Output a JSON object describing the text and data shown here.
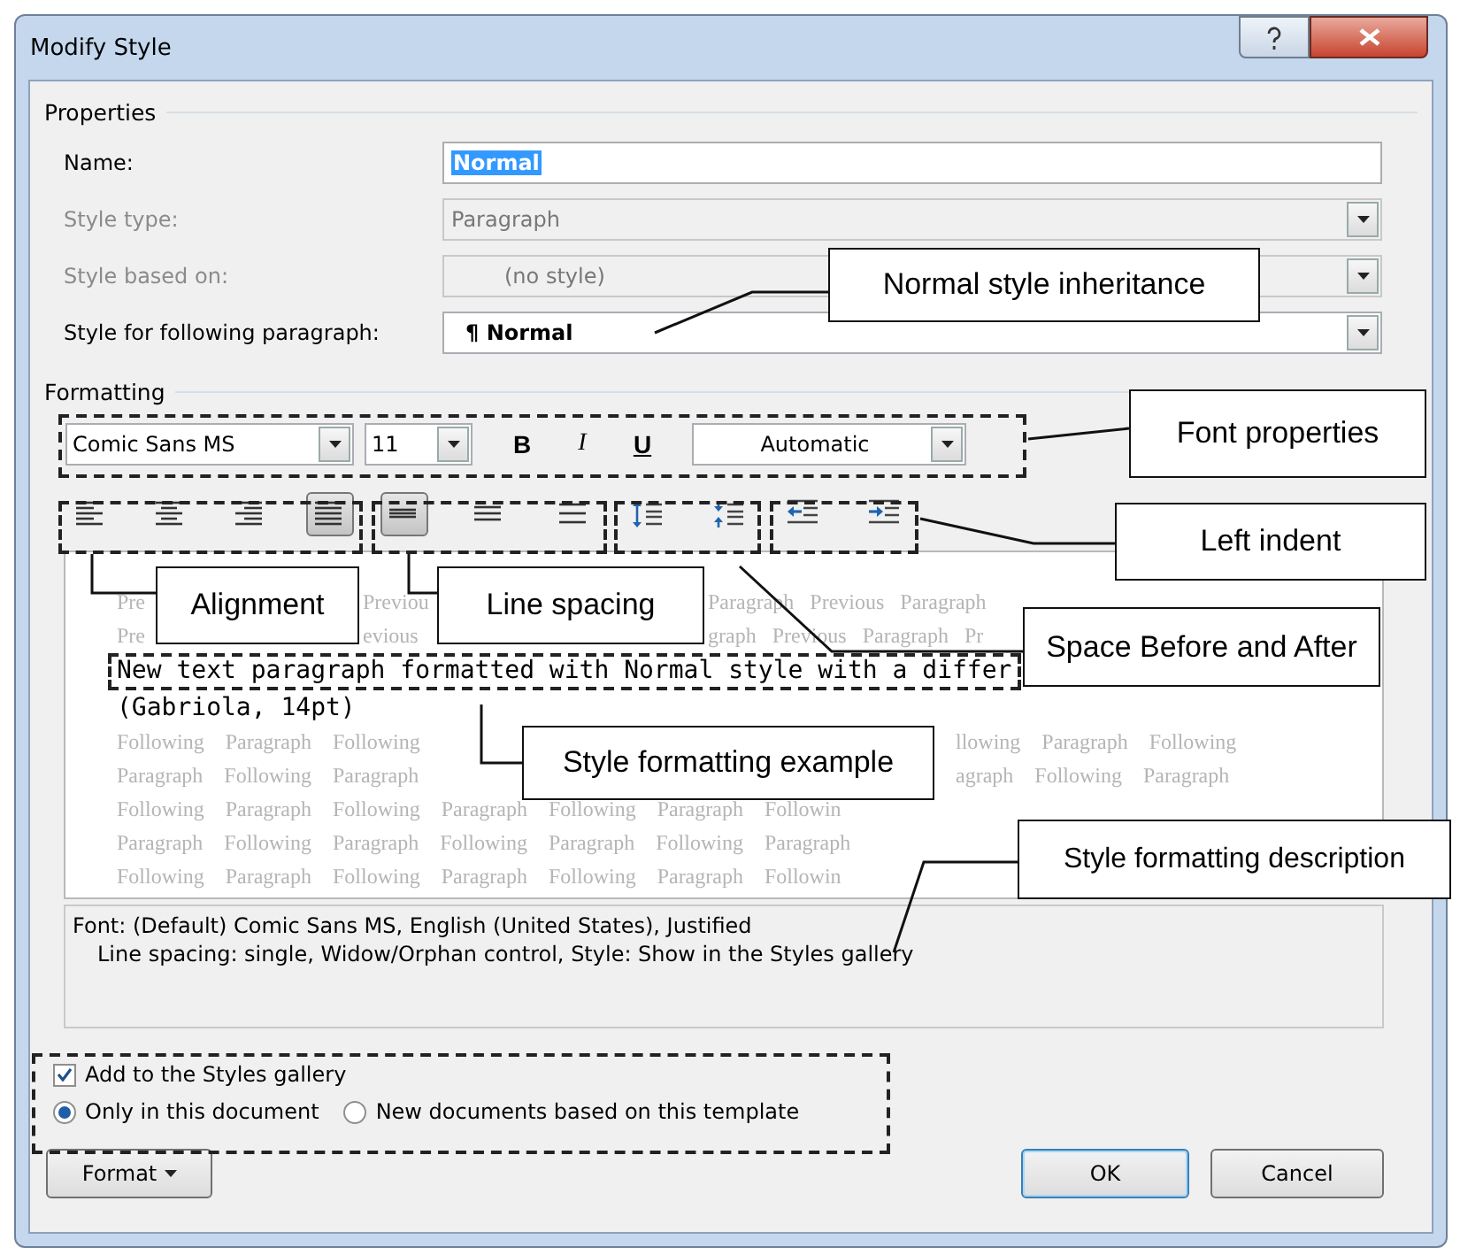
{
  "window": {
    "title": "Modify Style"
  },
  "properties": {
    "heading": "Properties",
    "fields": [
      {
        "label": "Name:",
        "value": "Normal",
        "kind": "text",
        "disabled": false,
        "highlighted": true
      },
      {
        "label": "Style type:",
        "value": "Paragraph",
        "kind": "dropdown",
        "disabled": true,
        "highlighted": false
      },
      {
        "label": "Style based on:",
        "value": "(no style)",
        "kind": "dropdown",
        "disabled": true,
        "highlighted": false
      },
      {
        "label": "Style for following paragraph:",
        "value": "¶ Normal",
        "kind": "dropdown",
        "disabled": false,
        "highlighted": false
      }
    ]
  },
  "formatting": {
    "heading": "Formatting",
    "font": "Comic Sans MS",
    "size": "11",
    "style_buttons": [
      {
        "label": "B",
        "kind": "bold"
      },
      {
        "label": "I",
        "kind": "italic"
      },
      {
        "label": "U",
        "kind": "underline"
      }
    ],
    "font_color": "Automatic",
    "button_groups": [
      [
        {
          "kind": "align-left",
          "selected": false
        },
        {
          "kind": "align-center",
          "selected": false
        },
        {
          "kind": "align-right",
          "selected": false
        },
        {
          "kind": "justify",
          "selected": true
        }
      ],
      [
        {
          "kind": "single",
          "selected": true
        },
        {
          "kind": "one-half",
          "selected": false
        },
        {
          "kind": "double",
          "selected": false
        }
      ],
      [
        {
          "kind": "space-more",
          "selected": false
        },
        {
          "kind": "space-less",
          "selected": false
        }
      ],
      [
        {
          "kind": "indent-decrease",
          "selected": false
        },
        {
          "kind": "indent-increase",
          "selected": false
        }
      ]
    ]
  },
  "preview": {
    "previous_lines": [
      [
        "Pre",
        "Previou",
        "Paragraph Previous Paragraph"
      ],
      [
        "Pre",
        "evious",
        "graph Previous Paragraph Pr"
      ]
    ],
    "sample_lines": [
      "New text paragraph formatted with Normal style with a differ",
      "(Gabriola, 14pt)"
    ],
    "following_lines": [
      [
        "Following Paragraph Following",
        "llowing Paragraph Following"
      ],
      [
        "Paragraph Following Paragraph",
        "agraph Following Paragraph"
      ],
      [
        "Following Paragraph Following Paragraph Following Paragraph Followin"
      ],
      [
        "Paragraph Following Paragraph Following Paragraph Following Paragraph"
      ],
      [
        "Following Paragraph Following Paragraph Following Paragraph Followin"
      ]
    ]
  },
  "description": [
    "Font: (Default) Comic Sans MS, English (United States), Justified",
    "Line spacing:  single, Widow/Orphan control, Style: Show in the Styles gallery"
  ],
  "options": {
    "checkbox": {
      "label": "Add to the Styles gallery",
      "checked": true
    },
    "radios": [
      {
        "label": "Only in this document",
        "selected": true
      },
      {
        "label": "New documents based on this template",
        "selected": false
      }
    ]
  },
  "buttons": {
    "format": "Format",
    "ok": "OK",
    "cancel": "Cancel"
  },
  "annotations": [
    "Normal style inheritance",
    "Font properties",
    "Left indent",
    "Alignment",
    "Line spacing",
    "Space Before and After",
    "Style formatting example",
    "Style formatting description"
  ]
}
